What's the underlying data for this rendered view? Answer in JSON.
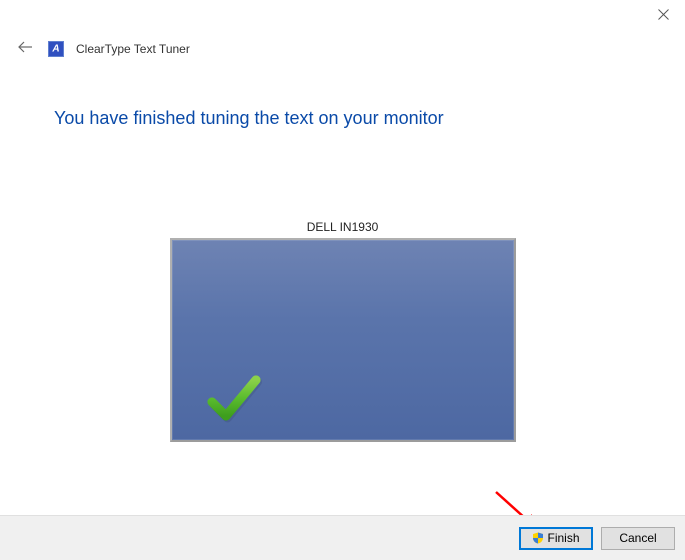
{
  "window": {
    "title": "ClearType Text Tuner"
  },
  "main": {
    "heading": "You have finished tuning the text on your monitor",
    "monitor_name": "DELL IN1930"
  },
  "footer": {
    "finish_label": "Finish",
    "cancel_label": "Cancel"
  }
}
